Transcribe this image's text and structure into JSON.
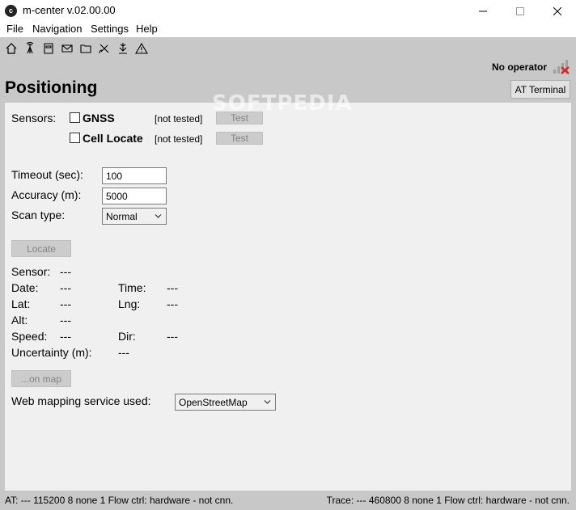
{
  "window": {
    "title": "m-center v.02.00.00",
    "app_icon_letter": "c"
  },
  "menu": {
    "file": "File",
    "navigation": "Navigation",
    "settings": "Settings",
    "help": "Help"
  },
  "toolbar": {
    "icons": [
      "home-icon",
      "antenna-icon",
      "sim-card-icon",
      "mail-icon",
      "folder-icon",
      "satellite-icon",
      "download-icon",
      "warning-icon"
    ]
  },
  "operator": {
    "label": "No operator",
    "signal_color": "#e0201b"
  },
  "page": {
    "title": "Positioning",
    "at_terminal_label": "AT Terminal"
  },
  "watermark": "SOFTPEDIA",
  "sensors": {
    "label": "Sensors:",
    "gnss": {
      "name": "GNSS",
      "status": "[not tested]",
      "test_label": "Test",
      "checked": false
    },
    "cell_locate": {
      "name": "Cell Locate",
      "status": "[not tested]",
      "test_label": "Test",
      "checked": false
    }
  },
  "settings": {
    "timeout_label": "Timeout (sec):",
    "timeout_value": "100",
    "accuracy_label": "Accuracy (m):",
    "accuracy_value": "5000",
    "scan_type_label": "Scan type:",
    "scan_type_value": "Normal"
  },
  "locate_label": "Locate",
  "results": {
    "sensor_label": "Sensor:",
    "sensor_value": "---",
    "date_label": "Date:",
    "date_value": "---",
    "time_label": "Time:",
    "time_value": "---",
    "lat_label": "Lat:",
    "lat_value": "---",
    "lng_label": "Lng:",
    "lng_value": "---",
    "alt_label": "Alt:",
    "alt_value": "---",
    "speed_label": "Speed:",
    "speed_value": "---",
    "dir_label": "Dir:",
    "dir_value": "---",
    "uncertainty_label": "Uncertainty (m):",
    "uncertainty_value": "---"
  },
  "on_map_label": "...on map",
  "mapping": {
    "label": "Web mapping service used:",
    "value": "OpenStreetMap"
  },
  "status": {
    "at": "AT: --- 115200 8 none 1 Flow ctrl: hardware - not cnn.",
    "trace": "Trace: --- 460800 8 none 1 Flow ctrl: hardware - not cnn."
  }
}
